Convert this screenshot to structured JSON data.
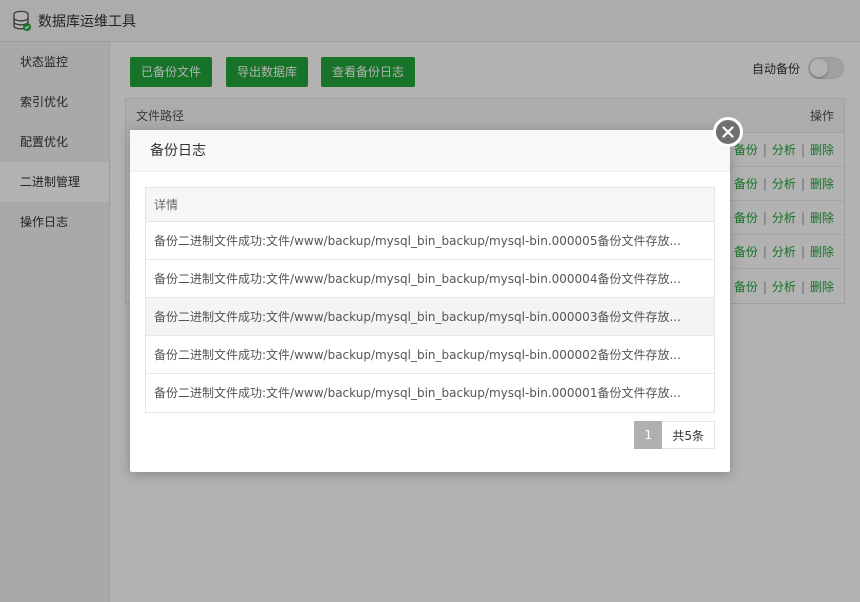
{
  "app": {
    "title": "数据库运维工具"
  },
  "sidebar": {
    "items": [
      {
        "label": "状态监控"
      },
      {
        "label": "索引优化"
      },
      {
        "label": "配置优化"
      },
      {
        "label": "二进制管理"
      },
      {
        "label": "操作日志"
      }
    ],
    "active_index": 3
  },
  "toolbar": {
    "backup_files_label": "已备份文件",
    "export_db_label": "导出数据库",
    "view_log_label": "查看备份日志",
    "auto_backup_label": "自动备份",
    "auto_backup_on": false
  },
  "file_table": {
    "col_path": "文件路径",
    "col_ops": "操作",
    "op_backup": "备份",
    "op_analyze": "分析",
    "op_delete": "删除",
    "sep": "|",
    "row_count": 5
  },
  "modal": {
    "title": "备份日志",
    "column": "详情",
    "rows": [
      "备份二进制文件成功:文件/www/backup/mysql_bin_backup/mysql-bin.000005备份文件存放...",
      "备份二进制文件成功:文件/www/backup/mysql_bin_backup/mysql-bin.000004备份文件存放...",
      "备份二进制文件成功:文件/www/backup/mysql_bin_backup/mysql-bin.000003备份文件存放...",
      "备份二进制文件成功:文件/www/backup/mysql_bin_backup/mysql-bin.000002备份文件存放...",
      "备份二进制文件成功:文件/www/backup/mysql_bin_backup/mysql-bin.000001备份文件存放..."
    ],
    "pager": {
      "current_page": "1",
      "total_text": "共5条"
    }
  },
  "colors": {
    "accent": "#20a53a",
    "overlay": "rgba(0,0,0,0.3)",
    "close": "#6f6f6f"
  },
  "icons": {
    "app": "database-icon",
    "close": "close-icon"
  }
}
